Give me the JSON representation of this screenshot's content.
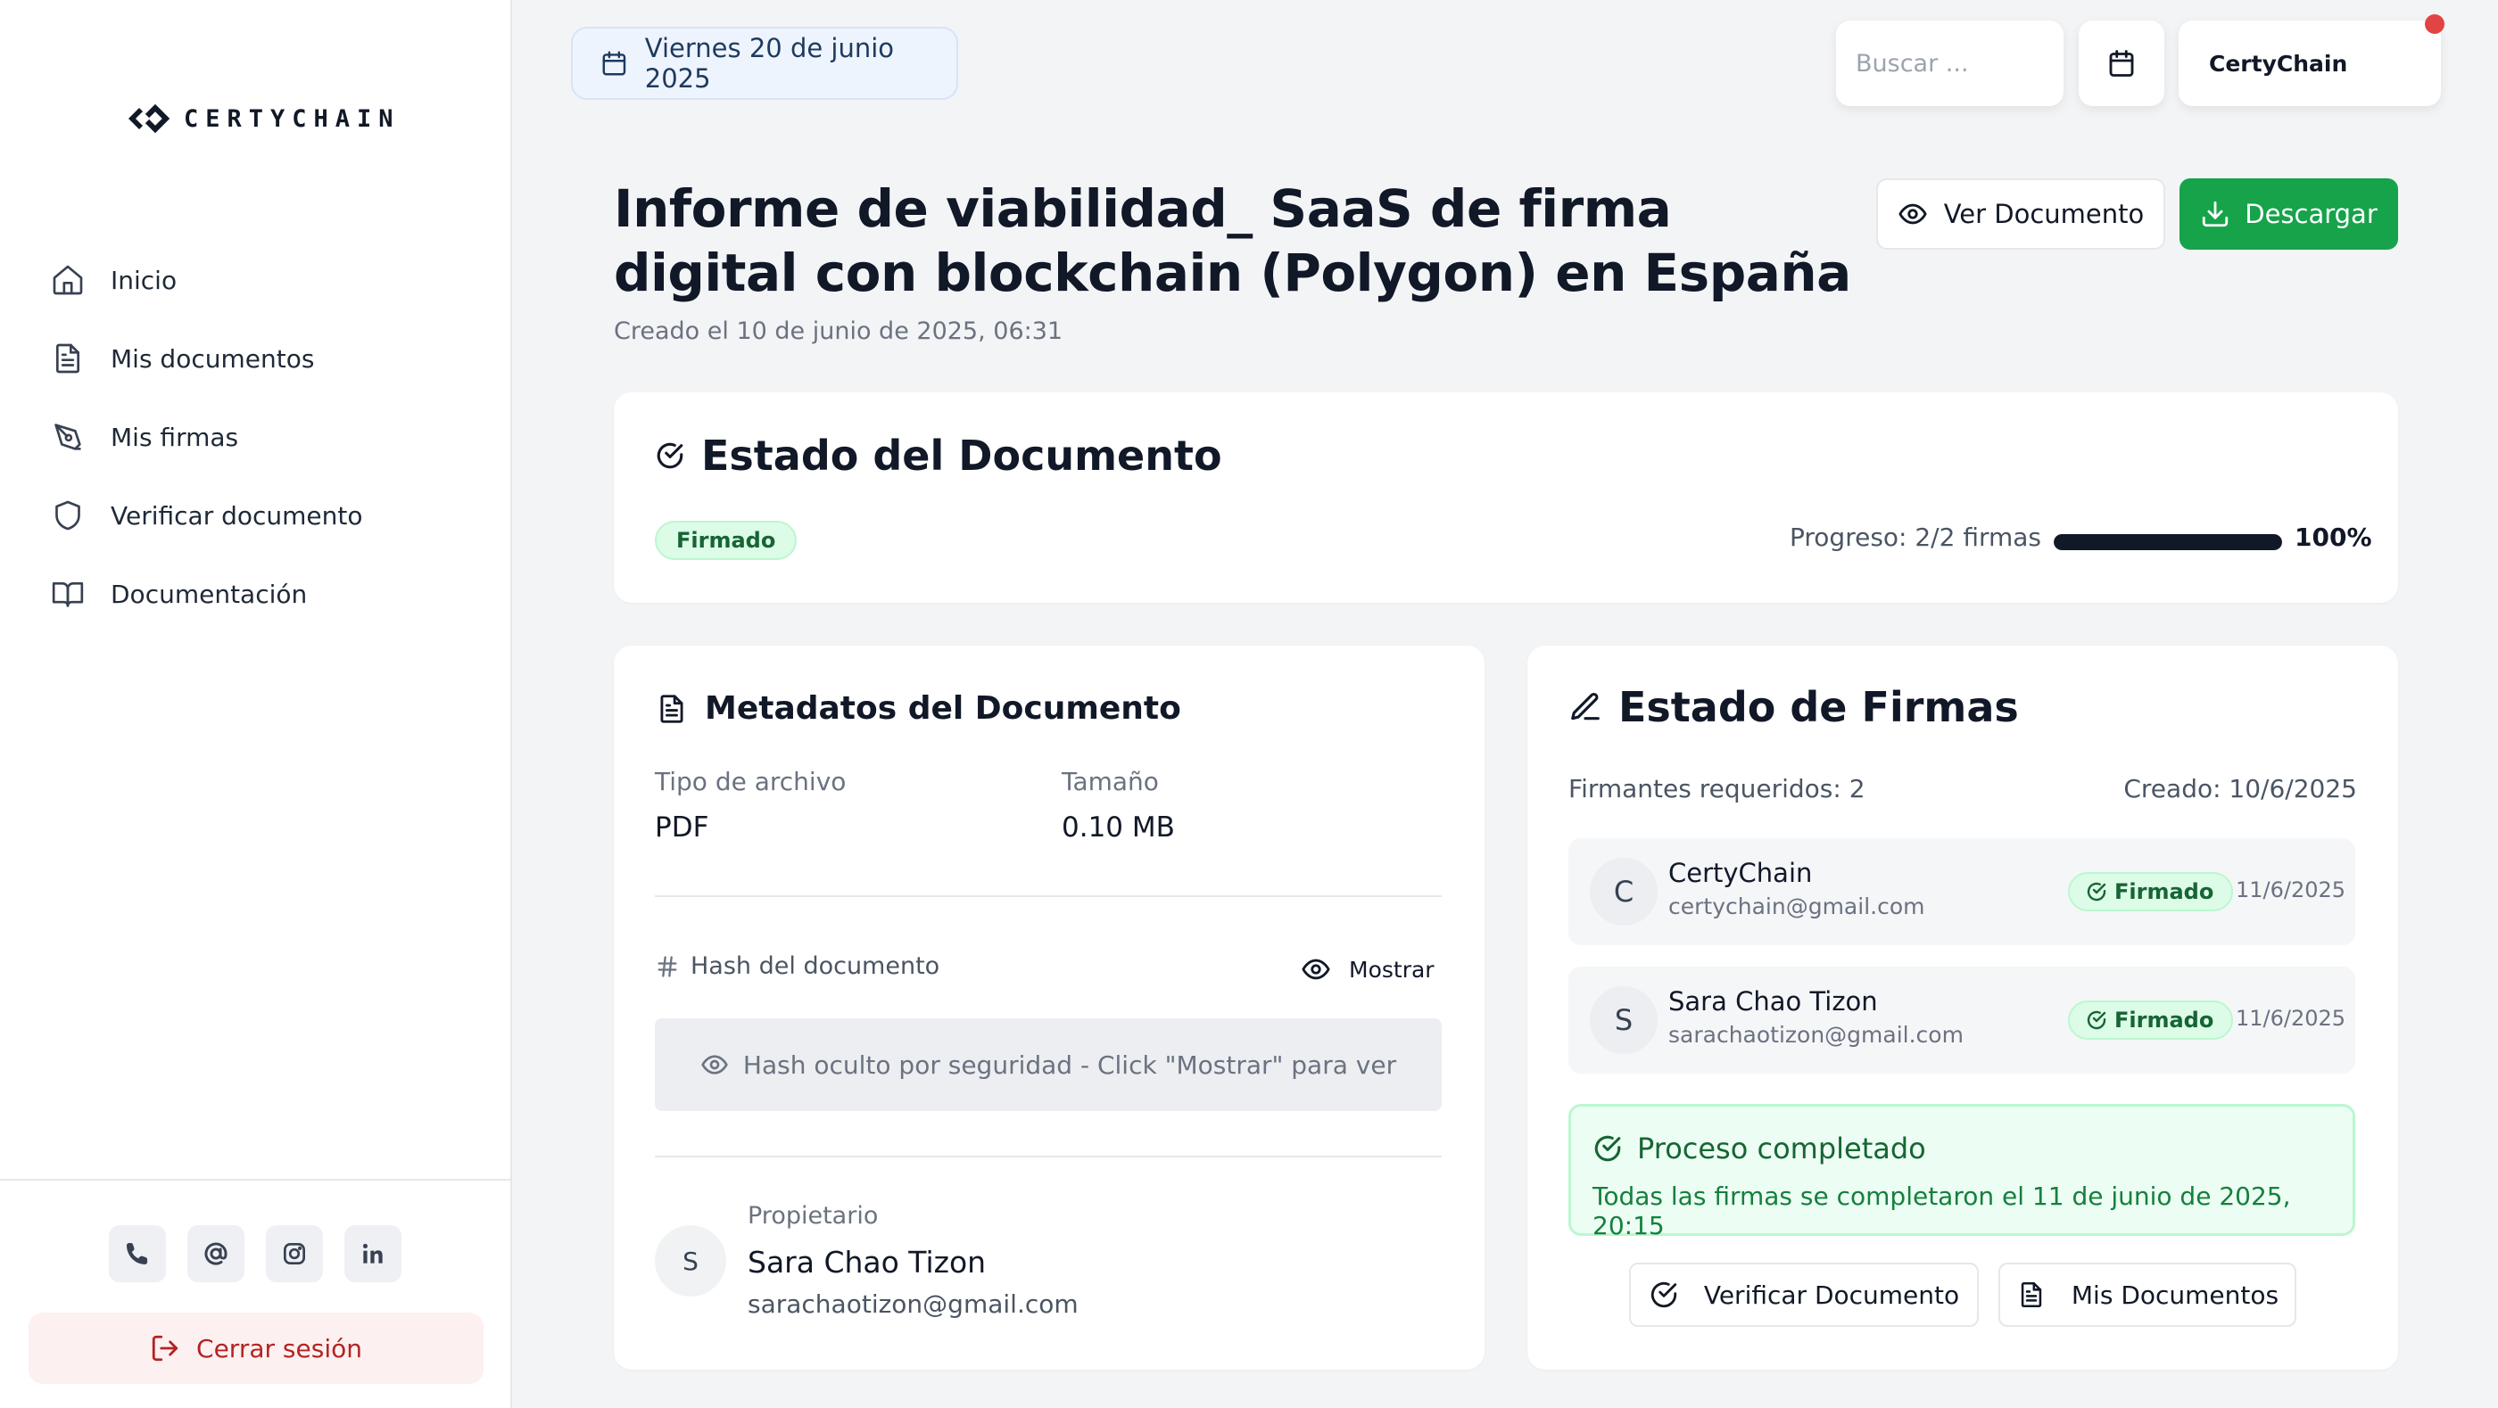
{
  "brand": {
    "logo_text": "CERTYCHAIN"
  },
  "sidebar": {
    "items": [
      {
        "label": "Inicio",
        "icon": "home-icon"
      },
      {
        "label": "Mis documentos",
        "icon": "file-text-icon"
      },
      {
        "label": "Mis firmas",
        "icon": "pen-tool-icon"
      },
      {
        "label": "Verificar documento",
        "icon": "shield-icon"
      },
      {
        "label": "Documentación",
        "icon": "book-open-icon"
      }
    ],
    "socials": [
      "phone-icon",
      "at-sign-icon",
      "instagram-icon",
      "linkedin-icon"
    ],
    "logout_label": "Cerrar sesión"
  },
  "topbar": {
    "date": "Viernes 20 de junio 2025",
    "search_placeholder": "Buscar ...",
    "user_label": "CertyChain",
    "has_notification": true
  },
  "document": {
    "title": "Informe de viabilidad_ SaaS de firma digital con blockchain (Polygon) en España",
    "created": "Creado el 10 de junio de 2025, 06:31",
    "view_button": "Ver Documento",
    "download_button": "Descargar"
  },
  "status_card": {
    "title": "Estado del Documento",
    "badge": "Firmado",
    "progress_label": "Progreso: 2/2 firmas",
    "progress_value": 1.0,
    "progress_pct": "100%"
  },
  "metadata_card": {
    "title": "Metadatos del Documento",
    "file_type_label": "Tipo de archivo",
    "file_type_value": "PDF",
    "size_label": "Tamaño",
    "size_value": "0.10 MB",
    "hash_label": "Hash del documento",
    "hash_show_button": "Mostrar",
    "hash_hidden_text": "Hash oculto por seguridad - Click \"Mostrar\" para ver",
    "owner_label": "Propietario",
    "owner_initial": "S",
    "owner_name": "Sara Chao Tizon",
    "owner_email": "sarachaotizon@gmail.com"
  },
  "signatures_card": {
    "title": "Estado de Firmas",
    "required": "Firmantes requeridos: 2",
    "created": "Creado: 10/6/2025",
    "signers": [
      {
        "initial": "C",
        "name": "CertyChain",
        "email": "certychain@gmail.com",
        "status": "Firmado",
        "date": "11/6/2025"
      },
      {
        "initial": "S",
        "name": "Sara Chao Tizon",
        "email": "sarachaotizon@gmail.com",
        "status": "Firmado",
        "date": "11/6/2025"
      }
    ],
    "complete_title": "Proceso completado",
    "complete_text": "Todas las firmas se completaron el 11 de junio de 2025, 20:15",
    "verify_button": "Verificar Documento",
    "my_docs_button": "Mis Documentos"
  },
  "colors": {
    "accent_green": "#16a34a",
    "badge_green_bg": "#dcfce7",
    "logout_red": "#b42323",
    "notification_red": "#e24343"
  }
}
